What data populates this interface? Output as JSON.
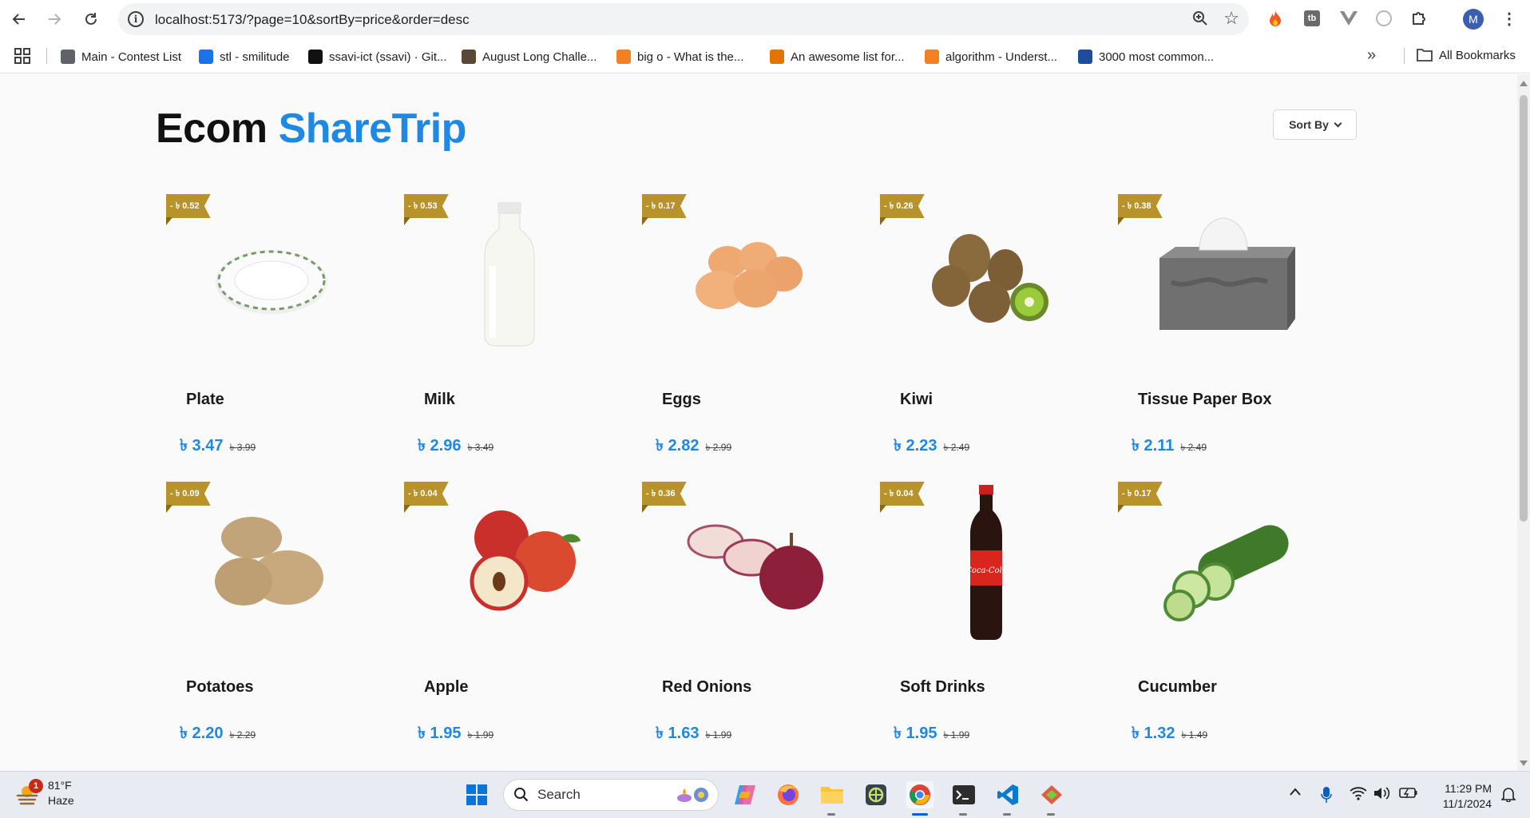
{
  "browser": {
    "url": "localhost:5173/?page=10&sortBy=price&order=desc",
    "profile_initial": "M",
    "bookmarks": [
      {
        "label": "Main - Contest List",
        "icon": "globe-icon",
        "color": "#5f6368"
      },
      {
        "label": "stl - smilitude",
        "icon": "doc-icon",
        "color": "#1a73e8"
      },
      {
        "label": "ssavi-ict (ssavi) · Git...",
        "icon": "github-icon",
        "color": "#111111"
      },
      {
        "label": "August Long Challe...",
        "icon": "codechef-icon",
        "color": "#5b4638"
      },
      {
        "label": "big o - What is the...",
        "icon": "stackoverflow-icon",
        "color": "#f48024"
      },
      {
        "label": "An awesome list for...",
        "icon": "chart-icon",
        "color": "#e37400"
      },
      {
        "label": "algorithm - Underst...",
        "icon": "stackoverflow-icon",
        "color": "#f48024"
      },
      {
        "label": "3000 most common...",
        "icon": "ef-icon",
        "color": "#1d4e9e"
      }
    ],
    "all_bookmarks_label": "All Bookmarks"
  },
  "page": {
    "brand_part1": "Ecom",
    "brand_part2": "ShareTrip",
    "sort_label": "Sort By",
    "colors": {
      "accent": "#1e88e5",
      "ribbon": "#b8922a"
    },
    "products": [
      {
        "name": "Plate",
        "discount": "- ৳ 0.52",
        "price": "৳ 3.47",
        "old_price": "৳ 3.99",
        "icon": "plate-image"
      },
      {
        "name": "Milk",
        "discount": "- ৳ 0.53",
        "price": "৳ 2.96",
        "old_price": "৳ 3.49",
        "icon": "milk-bottle-image"
      },
      {
        "name": "Eggs",
        "discount": "- ৳ 0.17",
        "price": "৳ 2.82",
        "old_price": "৳ 2.99",
        "icon": "eggs-image"
      },
      {
        "name": "Kiwi",
        "discount": "- ৳ 0.26",
        "price": "৳ 2.23",
        "old_price": "৳ 2.49",
        "icon": "kiwi-image"
      },
      {
        "name": "Tissue Paper Box",
        "discount": "- ৳ 0.38",
        "price": "৳ 2.11",
        "old_price": "৳ 2.49",
        "icon": "tissue-box-image"
      },
      {
        "name": "Potatoes",
        "discount": "- ৳ 0.09",
        "price": "৳ 2.20",
        "old_price": "৳ 2.29",
        "icon": "potatoes-image"
      },
      {
        "name": "Apple",
        "discount": "- ৳ 0.04",
        "price": "৳ 1.95",
        "old_price": "৳ 1.99",
        "icon": "apple-image"
      },
      {
        "name": "Red Onions",
        "discount": "- ৳ 0.36",
        "price": "৳ 1.63",
        "old_price": "৳ 1.99",
        "icon": "red-onion-image"
      },
      {
        "name": "Soft Drinks",
        "discount": "- ৳ 0.04",
        "price": "৳ 1.95",
        "old_price": "৳ 1.99",
        "icon": "soda-bottle-image"
      },
      {
        "name": "Cucumber",
        "discount": "- ৳ 0.17",
        "price": "৳ 1.32",
        "old_price": "৳ 1.49",
        "icon": "cucumber-image"
      }
    ]
  },
  "taskbar": {
    "weather_temp": "81°F",
    "weather_desc": "Haze",
    "weather_badge": "1",
    "search_label": "Search",
    "time": "11:29 PM",
    "date": "11/1/2024"
  }
}
